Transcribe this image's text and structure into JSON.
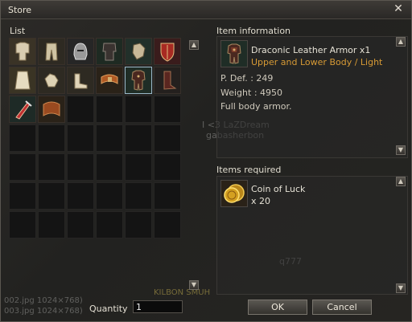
{
  "window": {
    "title": "Store"
  },
  "list": {
    "label": "List",
    "items": [
      {
        "icon": "light-armor-set-icon"
      },
      {
        "icon": "leather-pants-icon"
      },
      {
        "icon": "helmet-icon"
      },
      {
        "icon": "dark-leather-armor-icon"
      },
      {
        "icon": "gauntlet-icon"
      },
      {
        "icon": "shield-icon"
      },
      {
        "icon": "robe-icon"
      },
      {
        "icon": "gloves-icon"
      },
      {
        "icon": "boots-icon"
      },
      {
        "icon": "belt-icon"
      },
      {
        "icon": "draconic-leather-armor-icon",
        "selected": true
      },
      {
        "icon": "greaves-icon"
      },
      {
        "icon": "dagger-icon"
      },
      {
        "icon": "leather-belt-icon"
      }
    ],
    "total_cells": 42
  },
  "item_info": {
    "label": "Item information",
    "name": "Draconic Leather Armor  x1",
    "type": "Upper and Lower Body / Light",
    "pdef": "P. Def. : 249",
    "weight": "Weight : 4950",
    "description": "Full body armor."
  },
  "items_required": {
    "label": "Items required",
    "name": "Coin of Luck",
    "count": "x 20",
    "icon": "coin-of-luck-icon"
  },
  "quantity": {
    "label": "Quantity",
    "value": "1"
  },
  "buttons": {
    "ok": "OK",
    "cancel": "Cancel"
  },
  "background_text": {
    "player1": "I <3 LaZDream",
    "player2": "gabasherbon",
    "player3": "q777",
    "file1": "002.jpg 1024×768)",
    "file2": "003.jpg 1024×768)",
    "caption": "KILBON SMUH"
  },
  "colors": {
    "item_type": "#d79a35",
    "accent_border": "#9ab8c8"
  }
}
